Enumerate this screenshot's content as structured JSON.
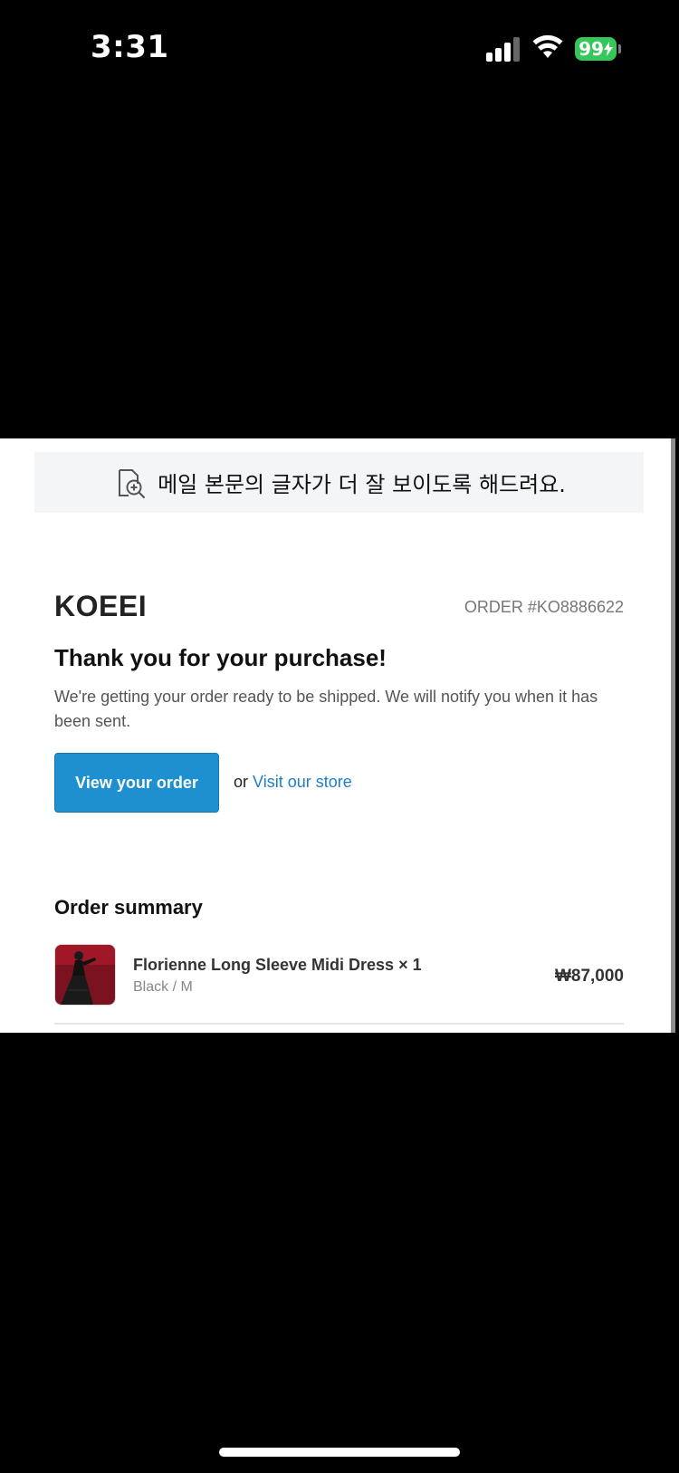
{
  "status_bar": {
    "time": "3:31",
    "battery": "99"
  },
  "zoom_banner": {
    "text": "메일 본문의 글자가 더 잘 보이도록 해드려요.",
    "icon": "zoom-in-document-icon"
  },
  "email": {
    "brand": "KOEEI",
    "order_number": "ORDER #KO8886622",
    "headline": "Thank you for your purchase!",
    "message": "We're getting your order ready to be shipped. We will notify you when it has been sent.",
    "view_order_label": "View your order",
    "or_text": "or",
    "visit_store_label": "Visit our store",
    "summary_title": "Order summary",
    "items": [
      {
        "name": "Florienne Long Sleeve Midi Dress × 1",
        "variant": "Black / M",
        "price": "₩87,000"
      }
    ]
  },
  "colors": {
    "accent": "#1e90d0",
    "link": "#1e7fc4",
    "battery": "#34c759"
  }
}
